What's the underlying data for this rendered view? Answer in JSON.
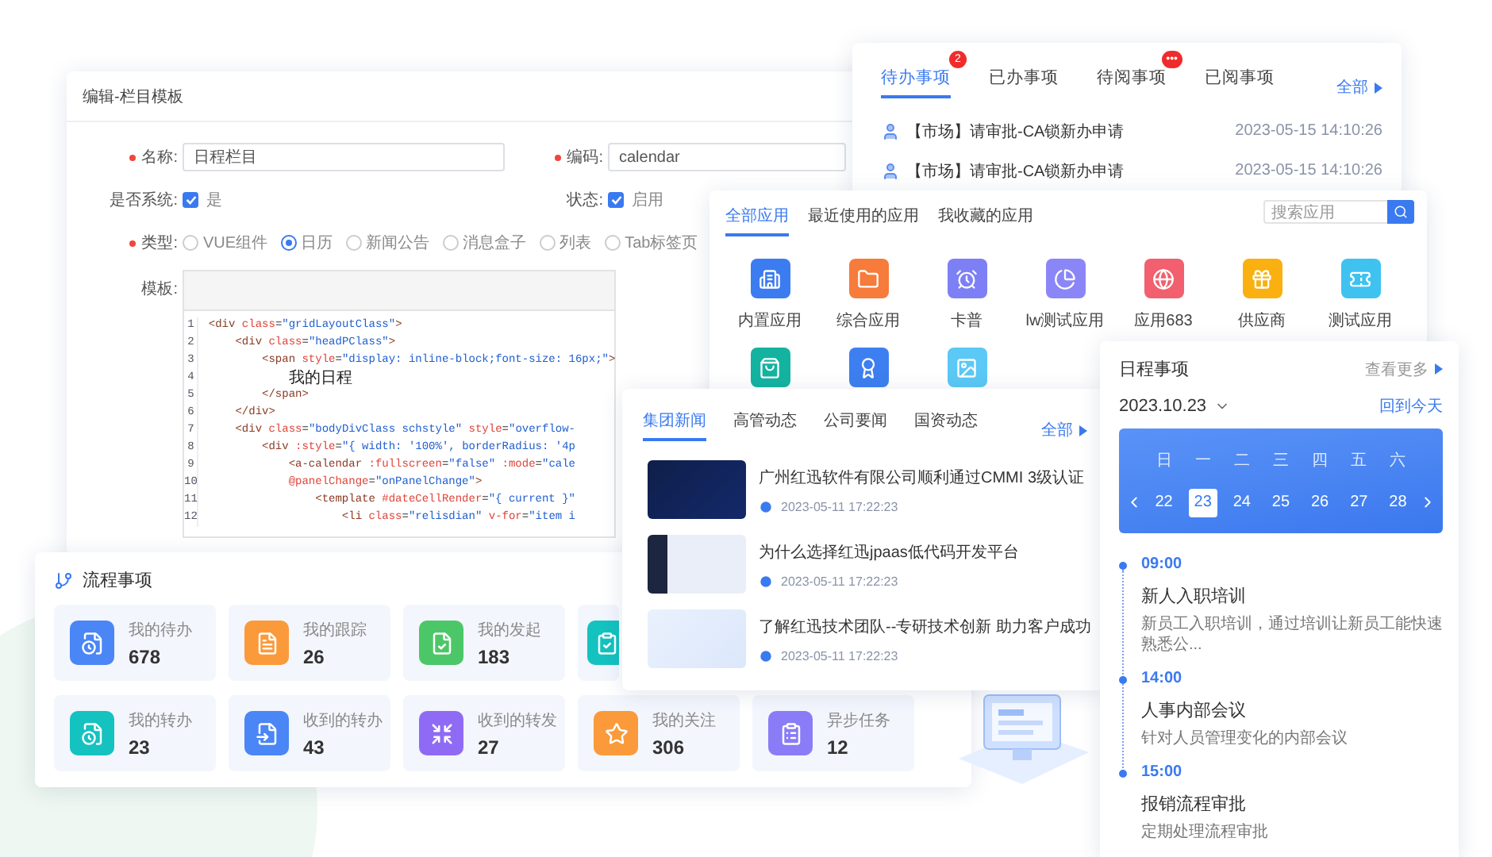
{
  "editor": {
    "title": "编辑-栏目模板",
    "row_1": [
      {
        "kind": "input",
        "required": true,
        "label": "名称:",
        "value": "日程栏目"
      },
      {
        "kind": "input",
        "required": true,
        "label": "编码:",
        "value": "calendar"
      }
    ],
    "row_2": [
      {
        "kind": "checkbox",
        "label": "是否系统:",
        "option": "是",
        "checked": true
      },
      {
        "kind": "checkbox",
        "label": "状态:",
        "option": "启用",
        "checked": true
      }
    ],
    "type": {
      "required": true,
      "label": "类型:",
      "options": [
        {
          "label": "VUE组件",
          "selected": false
        },
        {
          "label": "日历",
          "selected": true
        },
        {
          "label": "新闻公告",
          "selected": false
        },
        {
          "label": "消息盒子",
          "selected": false
        },
        {
          "label": "列表",
          "selected": false
        },
        {
          "label": "Tab标签页",
          "selected": false
        }
      ]
    },
    "template": {
      "label": "模板:",
      "lines": [
        {
          "number": "1",
          "kind": "code",
          "text": "<div class=\"gridLayoutClass\">"
        },
        {
          "number": "2",
          "kind": "code",
          "text": "    <div class=\"headPClass\">"
        },
        {
          "number": "3",
          "kind": "code",
          "text": "        <span style=\"display: inline-block;font-size: 16px;\">"
        },
        {
          "number": "4",
          "kind": "text",
          "text": "            我的日程"
        },
        {
          "number": "5",
          "kind": "code",
          "text": "        </span>"
        },
        {
          "number": "6",
          "kind": "code",
          "text": "    </div>"
        },
        {
          "number": "7",
          "kind": "code",
          "text": "    <div class=\"bodyDivClass schstyle\" style=\"overflow-"
        },
        {
          "number": "8",
          "kind": "code",
          "text": "        <div :style=\"{ width: '100%', borderRadius: '4p"
        },
        {
          "number": "9",
          "kind": "code",
          "text": "            <a-calendar :fullscreen=\"false\" :mode=\"cale"
        },
        {
          "number": "10",
          "kind": "code",
          "text": "            @panelChange=\"onPanelChange\">"
        },
        {
          "number": "11",
          "kind": "code",
          "text": "                <template #dateCellRender=\"{ current }\""
        },
        {
          "number": "12",
          "kind": "code",
          "text": "                    <li class=\"relisdian\" v-for=\"item i"
        }
      ]
    }
  },
  "todo": {
    "tabs": [
      {
        "label": "待办事项",
        "selected": true,
        "badge": "2"
      },
      {
        "label": "已办事项",
        "selected": false
      },
      {
        "label": "待阅事项",
        "selected": false,
        "badge": "•••"
      },
      {
        "label": "已阅事项",
        "selected": false
      }
    ],
    "more": "全部",
    "rows": [
      {
        "title": "【市场】请审批-CA锁新办申请",
        "time": "2023-05-15 14:10:26"
      },
      {
        "title": "【市场】请审批-CA锁新办申请",
        "time": "2023-05-15 14:10:26"
      }
    ]
  },
  "apps": {
    "tabs": [
      {
        "label": "全部应用",
        "selected": true
      },
      {
        "label": "最近使用的应用",
        "selected": false
      },
      {
        "label": "我收藏的应用",
        "selected": false
      }
    ],
    "search": {
      "placeholder": "搜索应用"
    },
    "items": [
      {
        "label": "内置应用",
        "color": "#3b7cf0"
      },
      {
        "label": "综合应用",
        "color": "#f77b3a"
      },
      {
        "label": "卡普",
        "color": "#7d80f5"
      },
      {
        "label": "lw测试应用",
        "color": "#8b86f7"
      },
      {
        "label": "应用683",
        "color": "#f25f6e"
      },
      {
        "label": "供应商",
        "color": "#f9b010"
      },
      {
        "label": "测试应用",
        "color": "#3fc2f0"
      },
      {
        "color": "#14b3a0"
      },
      {
        "color": "#3d7ff0"
      },
      {
        "color": "#5bc8f5"
      }
    ]
  },
  "flow": {
    "title": "流程事项",
    "row_1": [
      {
        "label": "我的待办",
        "value": "678",
        "color": "#4a86f5"
      },
      {
        "label": "我的跟踪",
        "value": "26",
        "color": "#fb9a3a"
      },
      {
        "label": "我的发起",
        "value": "183",
        "color": "#4cc767"
      },
      {
        "color": "#14c2c0"
      }
    ],
    "row_2": [
      {
        "label": "我的转办",
        "value": "23",
        "color": "#14c2c0"
      },
      {
        "label": "收到的转办",
        "value": "43",
        "color": "#4a86f5"
      },
      {
        "label": "收到的转发",
        "value": "27",
        "color": "#8f6bf5"
      },
      {
        "label": "我的关注",
        "value": "306",
        "color": "#fb9a3a"
      },
      {
        "label": "异步任务",
        "value": "12",
        "color": "#8a7cf7"
      }
    ]
  },
  "news": {
    "tabs": [
      {
        "label": "集团新闻",
        "selected": true
      },
      {
        "label": "高管动态",
        "selected": false
      },
      {
        "label": "公司要闻",
        "selected": false
      },
      {
        "label": "国资动态",
        "selected": false
      }
    ],
    "more": "全部",
    "items": [
      {
        "title": "广州红迅软件有限公司顺利通过CMMI 3级认证",
        "date": "2023-05-11 17:22:23"
      },
      {
        "title": "为什么选择红迅jpaas低代码开发平台",
        "date": "2023-05-11 17:22:23"
      },
      {
        "title": "了解红迅技术团队--专研技术创新 助力客户成功",
        "date": "2023-05-11 17:22:23"
      }
    ]
  },
  "schedule": {
    "title": "日程事项",
    "more": "查看更多",
    "date": "2023.10.23",
    "today": "回到今天",
    "weekdays": [
      "日",
      "一",
      "二",
      "三",
      "四",
      "五",
      "六"
    ],
    "days": [
      {
        "label": "22",
        "selected": false
      },
      {
        "label": "23",
        "selected": true
      },
      {
        "label": "24",
        "selected": false
      },
      {
        "label": "25",
        "selected": false
      },
      {
        "label": "26",
        "selected": false
      },
      {
        "label": "27",
        "selected": false
      },
      {
        "label": "28",
        "selected": false
      }
    ],
    "events": [
      {
        "time": "09:00",
        "title": "新人入职培训",
        "desc": "新员工入职培训，通过培训让新员工能快速熟悉公..."
      },
      {
        "time": "14:00",
        "title": "人事内部会议",
        "desc": "针对人员管理变化的内部会议"
      },
      {
        "time": "15:00",
        "title": "报销流程审批",
        "desc": "定期处理流程审批"
      }
    ]
  }
}
